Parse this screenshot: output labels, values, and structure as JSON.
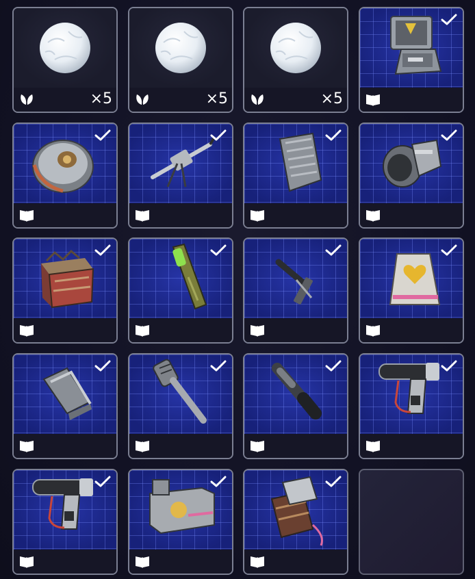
{
  "inventory": {
    "slots": [
      {
        "kind": "snowball",
        "bg": "dark",
        "bar_icon": "leaf-icon",
        "quantity": "×5",
        "checked": false
      },
      {
        "kind": "snowball",
        "bg": "dark",
        "bar_icon": "leaf-icon",
        "quantity": "×5",
        "checked": false
      },
      {
        "kind": "snowball",
        "bg": "dark",
        "bar_icon": "leaf-icon",
        "quantity": "×5",
        "checked": false
      },
      {
        "kind": "toolkit-case",
        "bg": "blueprint",
        "bar_icon": "blueprint-book-icon",
        "quantity": "",
        "checked": true
      },
      {
        "kind": "round-mine",
        "bg": "blueprint",
        "bar_icon": "blueprint-book-icon",
        "quantity": "",
        "checked": true
      },
      {
        "kind": "tripod-rifle",
        "bg": "blueprint",
        "bar_icon": "blueprint-book-icon",
        "quantity": "",
        "checked": true
      },
      {
        "kind": "metal-container",
        "bg": "blueprint",
        "bar_icon": "blueprint-book-icon",
        "quantity": "",
        "checked": true
      },
      {
        "kind": "cylinder-device",
        "bg": "blueprint",
        "bar_icon": "blueprint-book-icon",
        "quantity": "",
        "checked": true
      },
      {
        "kind": "wooden-crate",
        "bg": "blueprint",
        "bar_icon": "blueprint-book-icon",
        "quantity": "",
        "checked": true
      },
      {
        "kind": "glow-tube",
        "bg": "blueprint",
        "bar_icon": "blueprint-book-icon",
        "quantity": "",
        "checked": true
      },
      {
        "kind": "hammer-tool",
        "bg": "blueprint",
        "bar_icon": "blueprint-book-icon",
        "quantity": "",
        "checked": true
      },
      {
        "kind": "heart-medkit",
        "bg": "blueprint",
        "bar_icon": "blueprint-book-icon",
        "quantity": "",
        "checked": true
      },
      {
        "kind": "metal-plates",
        "bg": "blueprint",
        "bar_icon": "blueprint-book-icon",
        "quantity": "",
        "checked": true
      },
      {
        "kind": "grenade-stick",
        "bg": "blueprint",
        "bar_icon": "blueprint-book-icon",
        "quantity": "",
        "checked": true
      },
      {
        "kind": "flashlight",
        "bg": "blueprint",
        "bar_icon": "blueprint-book-icon",
        "quantity": "",
        "checked": true
      },
      {
        "kind": "heat-gun",
        "bg": "blueprint",
        "bar_icon": "blueprint-book-icon",
        "quantity": "",
        "checked": true
      },
      {
        "kind": "heat-gun",
        "bg": "blueprint",
        "bar_icon": "blueprint-book-icon",
        "quantity": "",
        "checked": true
      },
      {
        "kind": "battery-box",
        "bg": "blueprint",
        "bar_icon": "blueprint-book-icon",
        "quantity": "",
        "checked": true
      },
      {
        "kind": "barrel-device",
        "bg": "blueprint",
        "bar_icon": "blueprint-book-icon",
        "quantity": "",
        "checked": true
      },
      {
        "kind": "empty",
        "bg": "empty",
        "bar_icon": "",
        "quantity": "",
        "checked": false
      }
    ]
  },
  "colors": {
    "blueprint": "#1b2689",
    "bar": "#161626",
    "border": "#7b7f92",
    "icon": "#ffffff"
  }
}
